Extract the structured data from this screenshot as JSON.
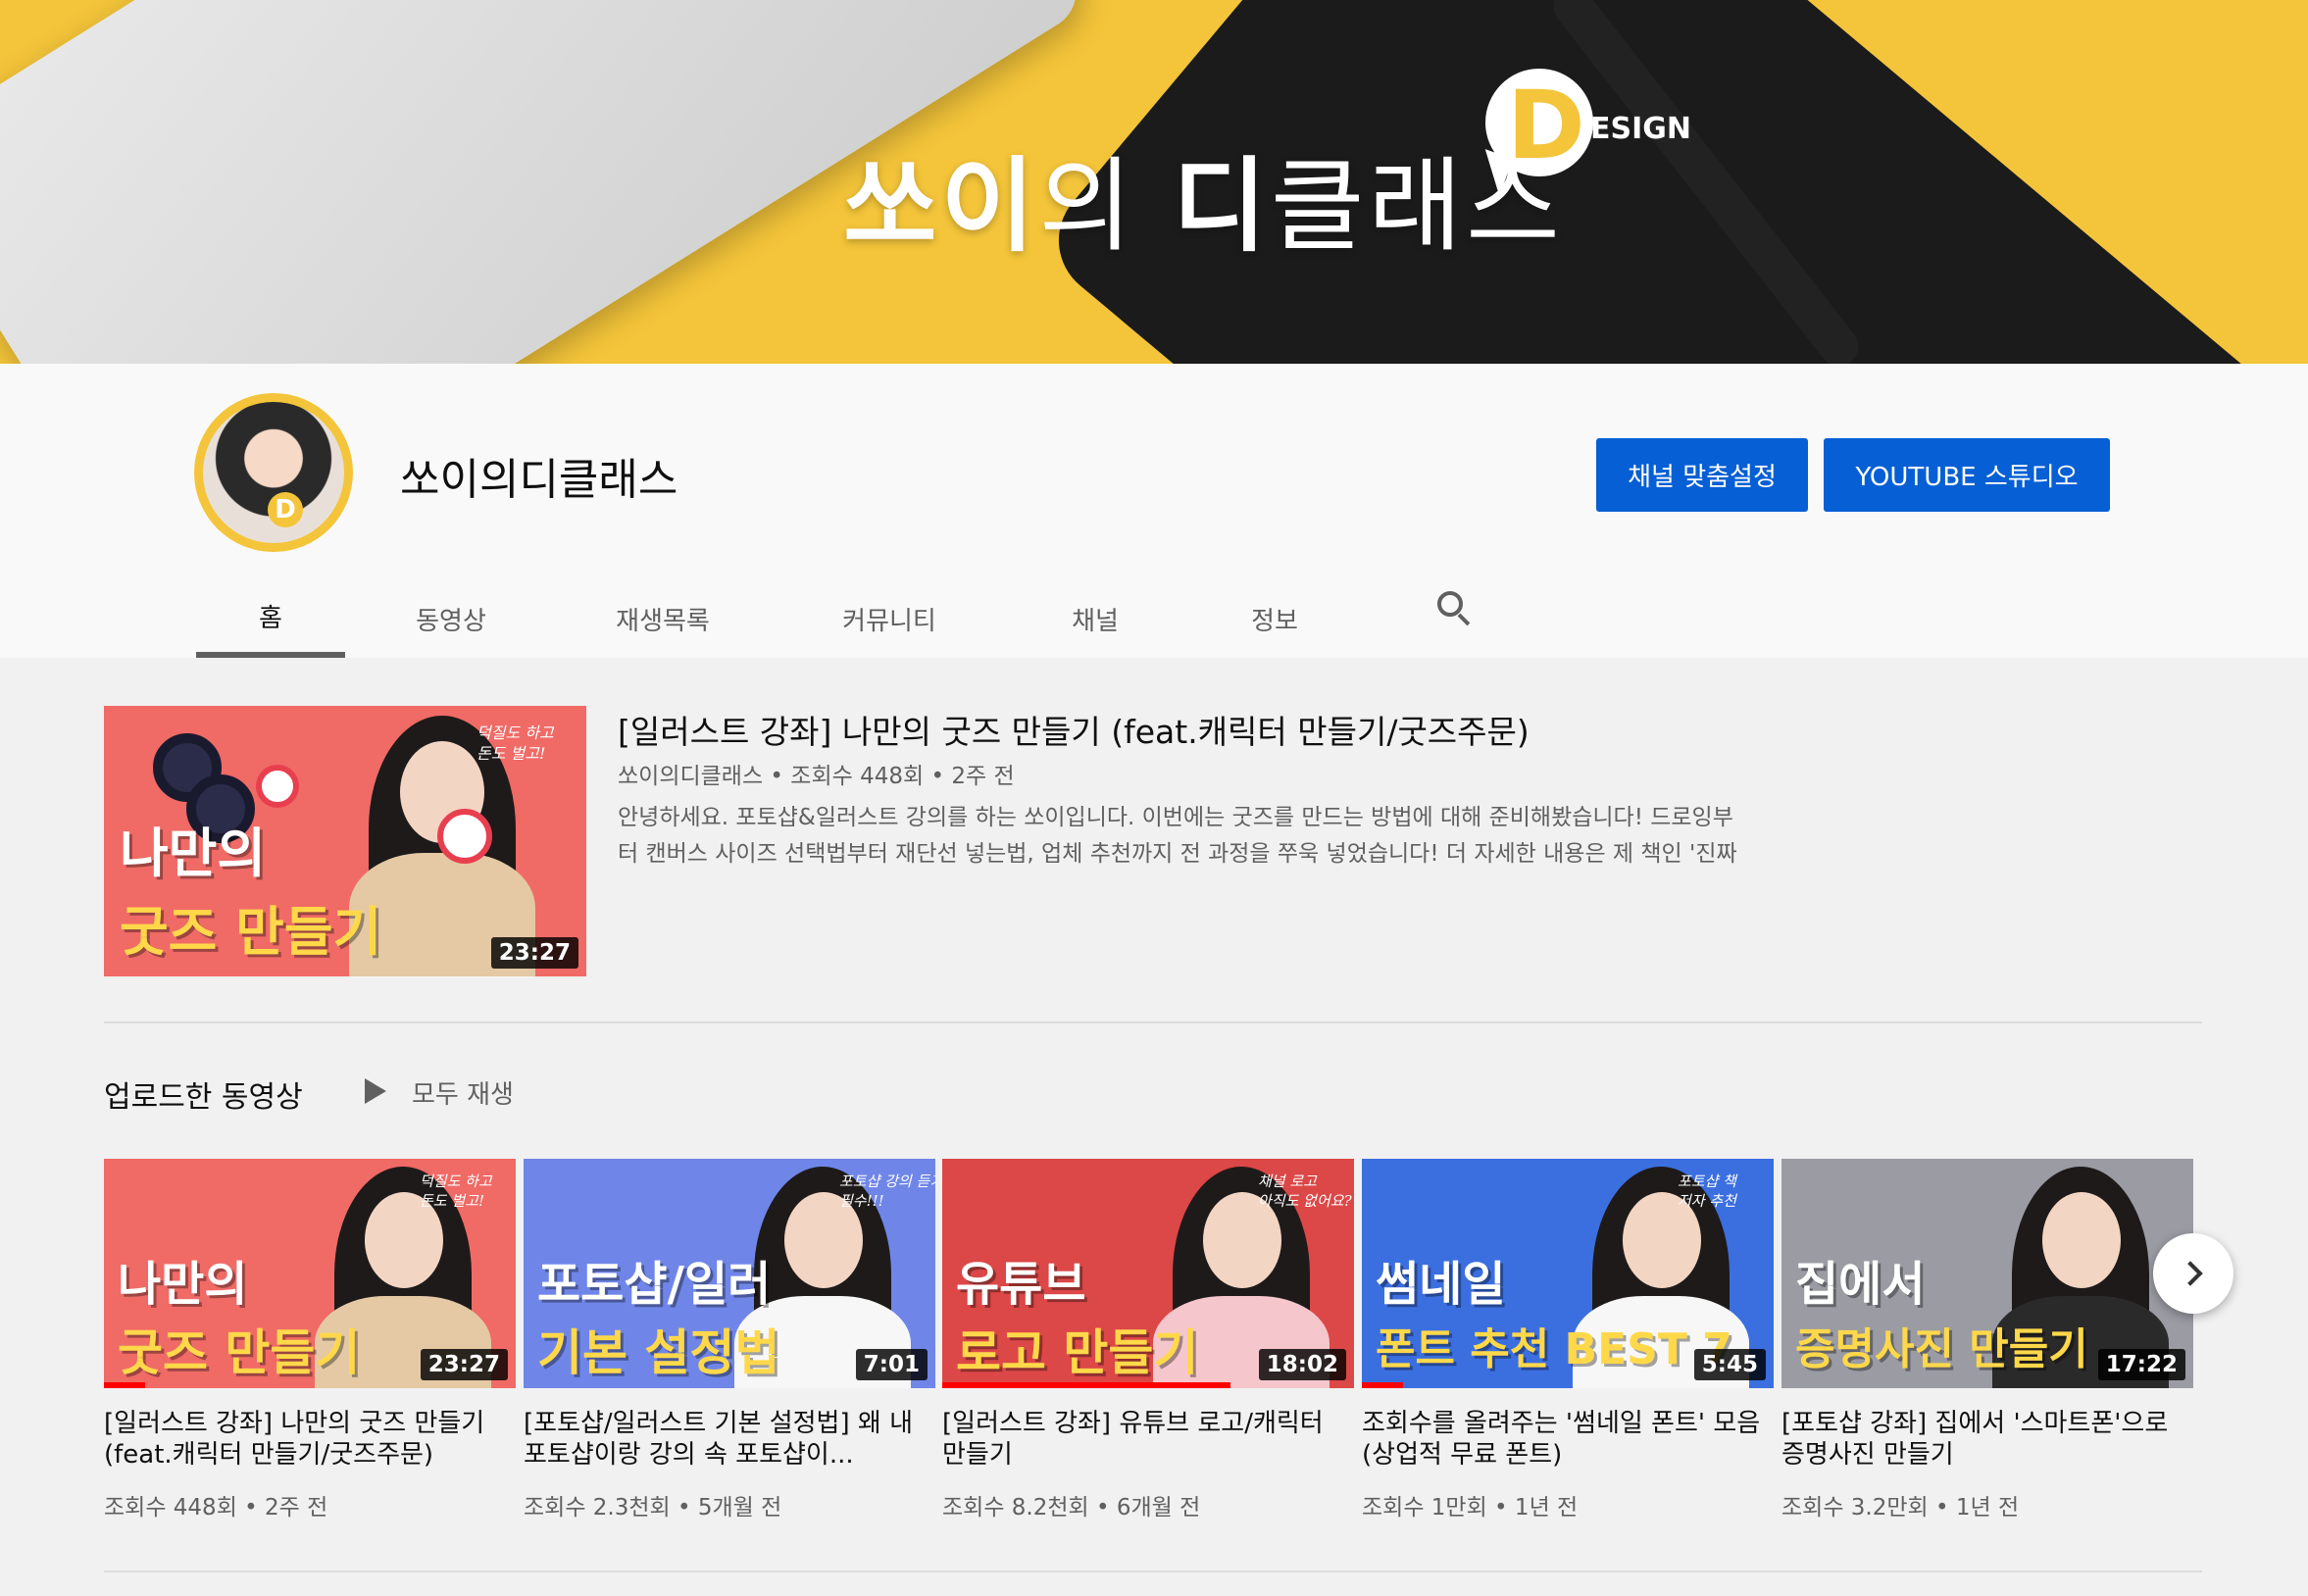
{
  "banner": {
    "title_bold1": "쏘이",
    "title_light1": "의 ",
    "title_bold2": "디",
    "title_light2": "클래스",
    "logo_letter": "D",
    "logo_text": "ESIGN"
  },
  "channel": {
    "name": "쏘이의디클래스",
    "avatar_letter": "D",
    "customize_label": "채널 맞춤설정",
    "studio_label": "YOUTUBE 스튜디오"
  },
  "tabs": [
    {
      "label": "홈",
      "active": true
    },
    {
      "label": "동영상"
    },
    {
      "label": "재생목록"
    },
    {
      "label": "커뮤니티"
    },
    {
      "label": "채널"
    },
    {
      "label": "정보"
    }
  ],
  "featured": {
    "title": "[일러스트 강좌] 나만의 굿즈 만들기 (feat.캐릭터 만들기/굿즈주문)",
    "meta": "쏘이의디클래스 • 조회수 448회 • 2주 전",
    "desc_line1": "안녕하세요. 포토샵&일러스트 강의를 하는 쏘이입니다. 이번에는 굿즈를 만드는 방법에 대해 준비해봤습니다! 드로잉부",
    "desc_line2": "터 캔버스 사이즈 선택법부터 재단선 넣는법, 업체 추천까지 전 과정을 쭈욱 넣었습니다! 더 자세한 내용은 제 책인 '진짜",
    "thumb_line1": "나만의",
    "thumb_line2": "굿즈 만들기",
    "thumb_note": "덕질도 하고\n돈도 벌고!",
    "duration": "23:27"
  },
  "uploads": {
    "section_title": "업로드한 동영상",
    "play_all": "모두 재생",
    "items": [
      {
        "title": "[일러스트 강좌] 나만의 굿즈 만들기 (feat.캐릭터 만들기/굿즈주문)",
        "meta": "조회수 448회 • 2주 전",
        "duration": "23:27",
        "thumb_line1": "나만의",
        "thumb_line2": "굿즈 만들기",
        "thumb_note": "덕질도 하고\n돈도 벌고!",
        "bg": "#f06a66",
        "progress": 0.1
      },
      {
        "title": "[포토샵/일러스트 기본 설정법] 왜 내 포토샵이랑 강의 속 포토샵이...",
        "meta": "조회수 2.3천회 • 5개월 전",
        "duration": "7:01",
        "thumb_line1": "포토샵/일러",
        "thumb_line2": "기본 설정법",
        "thumb_note": "포토샵 강의 듣기 전\n필수!!!",
        "bg": "#6f86e8",
        "progress": 0
      },
      {
        "title": "[일러스트 강좌] 유튜브 로고/캐릭터 만들기",
        "meta": "조회수 8.2천회 • 6개월 전",
        "duration": "18:02",
        "thumb_line1": "유튜브",
        "thumb_line2": "로고 만들기",
        "thumb_note": "채널 로고\n아직도 없어요?",
        "bg": "#dc4747",
        "progress": 0.7
      },
      {
        "title": "조회수를 올려주는 '썸네일 폰트' 모음 (상업적 무료 폰트)",
        "meta": "조회수 1만회 • 1년 전",
        "duration": "5:45",
        "thumb_line1": "썸네일",
        "thumb_line2": "폰트 추천 BEST 7",
        "thumb_note": "포토샵 책\n저자 추천",
        "bg": "#3b6fe0",
        "progress": 0.1
      },
      {
        "title": "[포토샵 강좌] 집에서 '스마트폰'으로 증명사진 만들기",
        "meta": "조회수 3.2만회 • 1년 전",
        "duration": "17:22",
        "thumb_line1": "집에서",
        "thumb_line2": "증명사진 만들기",
        "thumb_note": "",
        "bg": "#9a9ba3",
        "progress": 0
      }
    ]
  },
  "colors": {
    "banner_yellow": "#f4c53a",
    "button_blue": "#065fd4",
    "progress_red": "#ff0000"
  },
  "icons": {
    "search": "search-icon",
    "play": "play-icon",
    "next": "chevron-right-icon"
  }
}
